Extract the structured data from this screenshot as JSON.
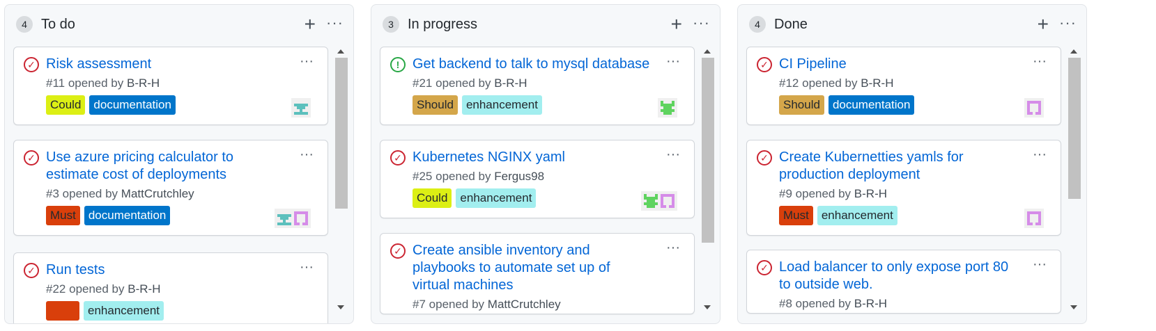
{
  "columns": [
    {
      "count": "4",
      "title": "To do",
      "add_icon": "plus-icon",
      "menu_icon": "kebab-horizontal-icon",
      "cards": [
        {
          "title_lines": [
            "Risk assessment"
          ],
          "number": "#11",
          "opened_by": "opened by",
          "author": "B-R-H",
          "state": "closed",
          "labels": [
            {
              "name": "Could",
              "bg": "#dcef14",
              "fg": "#24292e"
            },
            {
              "name": "documentation",
              "bg": "#0075ca",
              "fg": "#ffffff"
            }
          ],
          "avatars": [
            "teal-avatar"
          ]
        },
        {
          "title_lines": [
            "Use azure pricing calculator to",
            "estimate cost of deployments"
          ],
          "number": "#3",
          "opened_by": "opened by",
          "author": "MattCrutchley",
          "state": "closed",
          "labels": [
            {
              "name": "Must",
              "bg": "#d93f0b",
              "fg": "#24292e"
            },
            {
              "name": "documentation",
              "bg": "#0075ca",
              "fg": "#ffffff"
            }
          ],
          "avatars": [
            "teal-avatar",
            "violet-avatar"
          ]
        },
        {
          "title_lines": [
            "Run tests"
          ],
          "number": "#22",
          "opened_by": "opened by",
          "author": "B-R-H",
          "state": "closed",
          "labels": [
            {
              "name": "",
              "bg": "#d93f0b",
              "fg": "#24292e"
            },
            {
              "name": "enhancement",
              "bg": "#a2eeef",
              "fg": "#24292e"
            }
          ],
          "avatars": []
        }
      ]
    },
    {
      "count": "3",
      "title": "In progress",
      "add_icon": "plus-icon",
      "menu_icon": "kebab-horizontal-icon",
      "cards": [
        {
          "title_lines": [
            "Get backend to talk to mysql database"
          ],
          "number": "#21",
          "opened_by": "opened by",
          "author": "B-R-H",
          "state": "open",
          "labels": [
            {
              "name": "Should",
              "bg": "#d4a64a",
              "fg": "#24292e"
            },
            {
              "name": "enhancement",
              "bg": "#a2eeef",
              "fg": "#24292e"
            }
          ],
          "avatars": [
            "green-avatar"
          ]
        },
        {
          "title_lines": [
            "Kubernetes NGINX yaml"
          ],
          "number": "#25",
          "opened_by": "opened by",
          "author": "Fergus98",
          "state": "closed",
          "labels": [
            {
              "name": "Could",
              "bg": "#dcef14",
              "fg": "#24292e"
            },
            {
              "name": "enhancement",
              "bg": "#a2eeef",
              "fg": "#24292e"
            }
          ],
          "avatars": [
            "green-avatar",
            "violet-avatar"
          ]
        },
        {
          "title_lines": [
            "Create ansible inventory and",
            "playbooks to automate set up of",
            "virtual machines"
          ],
          "number": "#7",
          "opened_by": "opened by",
          "author": "MattCrutchley",
          "state": "closed",
          "labels": [],
          "avatars": []
        }
      ]
    },
    {
      "count": "4",
      "title": "Done",
      "add_icon": "plus-icon",
      "menu_icon": "kebab-horizontal-icon",
      "cards": [
        {
          "title_lines": [
            "CI Pipeline"
          ],
          "number": "#12",
          "opened_by": "opened by",
          "author": "B-R-H",
          "state": "closed",
          "labels": [
            {
              "name": "Should",
              "bg": "#d4a64a",
              "fg": "#24292e"
            },
            {
              "name": "documentation",
              "bg": "#0075ca",
              "fg": "#ffffff"
            }
          ],
          "avatars": [
            "violet-avatar"
          ]
        },
        {
          "title_lines": [
            "Create Kubernetties yamls for",
            "production deployment"
          ],
          "number": "#9",
          "opened_by": "opened by",
          "author": "B-R-H",
          "state": "closed",
          "labels": [
            {
              "name": "Must",
              "bg": "#d93f0b",
              "fg": "#24292e"
            },
            {
              "name": "enhancement",
              "bg": "#a2eeef",
              "fg": "#24292e"
            }
          ],
          "avatars": [
            "violet-avatar"
          ]
        },
        {
          "title_lines": [
            "Load balancer to only expose port 80",
            "to outside web."
          ],
          "number": "#8",
          "opened_by": "opened by",
          "author": "B-R-H",
          "state": "closed",
          "labels": [],
          "avatars": []
        }
      ]
    }
  ],
  "card_menu_icon": "kebab-horizontal-icon",
  "scroll": [
    {
      "position": 0.0,
      "visible_fraction": 0.62
    },
    {
      "position": 0.0,
      "visible_fraction": 0.76
    },
    {
      "position": 0.0,
      "visible_fraction": 0.58
    }
  ]
}
